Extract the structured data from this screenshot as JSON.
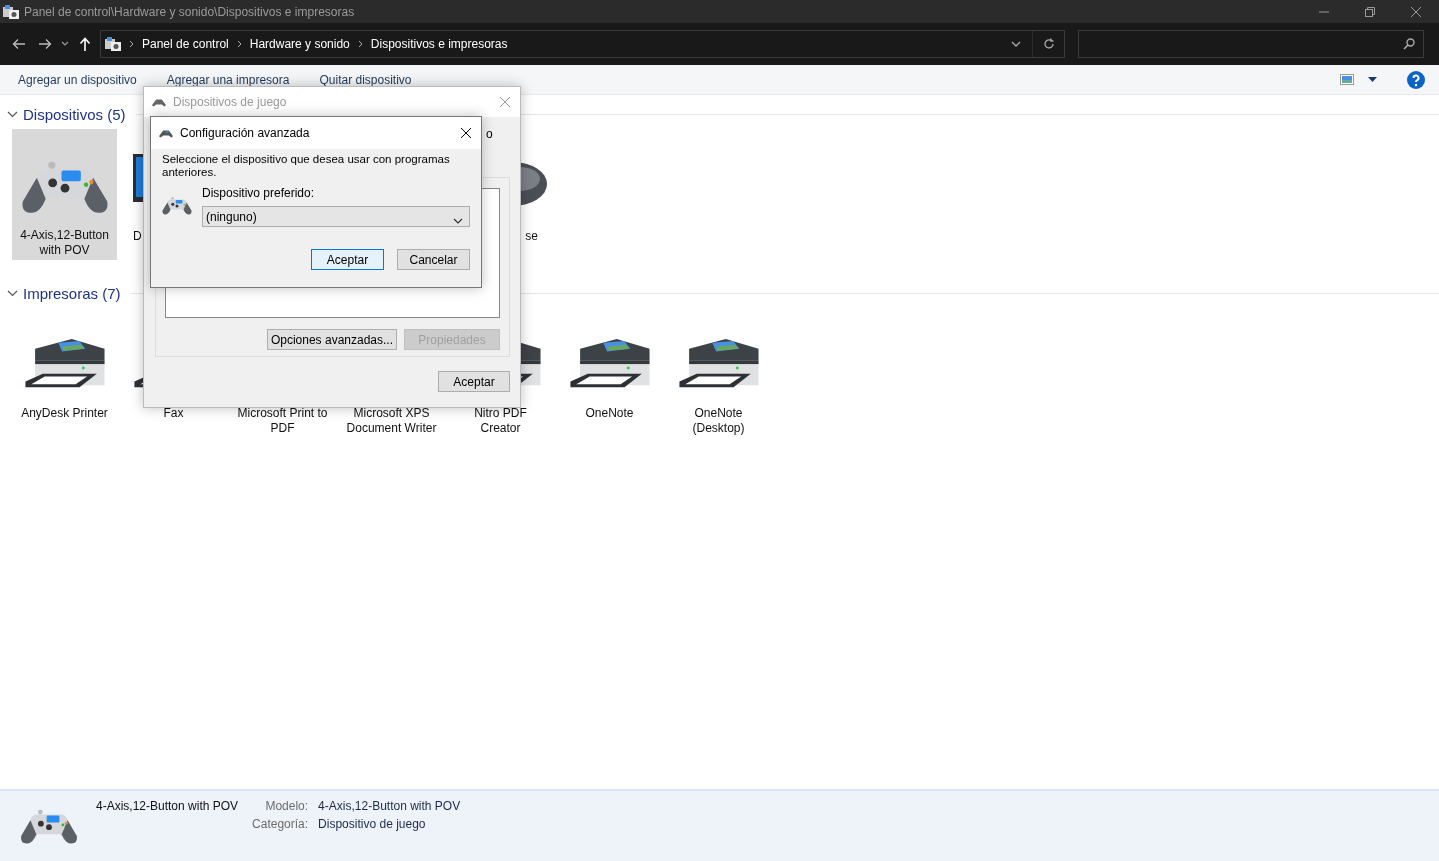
{
  "window": {
    "title": "Panel de control\\Hardware y sonido\\Dispositivos e impresoras"
  },
  "address": {
    "crumbs": [
      "Panel de control",
      "Hardware y sonido",
      "Dispositivos e impresoras"
    ]
  },
  "commands": [
    "Agregar un dispositivo",
    "Agregar una impresora",
    "Quitar dispositivo"
  ],
  "groups": [
    {
      "title": "Dispositivos (5)",
      "expanded": true,
      "items": [
        {
          "label": "4-Axis,12-Button with POV",
          "kind": "gamepad",
          "selected": true
        },
        {
          "label": "D",
          "kind": "monitor",
          "selected": false
        },
        {
          "label": "se",
          "kind": "mouse",
          "selected": false
        }
      ]
    },
    {
      "title": "Impresoras (7)",
      "expanded": true,
      "items": [
        {
          "label": "AnyDesk Printer",
          "kind": "printer",
          "selected": false
        },
        {
          "label": "Fax",
          "kind": "printer",
          "selected": false
        },
        {
          "label": "Microsoft Print to PDF",
          "kind": "printer",
          "selected": false
        },
        {
          "label": "Microsoft XPS Document Writer",
          "kind": "printer",
          "selected": false
        },
        {
          "label": "Nitro PDF Creator",
          "kind": "printer",
          "selected": false
        },
        {
          "label": "OneNote",
          "kind": "printer",
          "selected": false
        },
        {
          "label": "OneNote (Desktop)",
          "kind": "printer",
          "selected": false
        }
      ]
    }
  ],
  "details": {
    "name": "4-Axis,12-Button with POV",
    "fields": [
      {
        "label": "Modelo:",
        "value": "4-Axis,12-Button with POV"
      },
      {
        "label": "Categoría:",
        "value": "Dispositivo de juego"
      }
    ]
  },
  "game_dialog": {
    "title": "Dispositivos de juego",
    "fragment": "o",
    "buttons": [
      {
        "label": "Opciones avanzadas...",
        "disabled": false
      },
      {
        "label": "Propiedades",
        "disabled": true
      },
      {
        "label": "Aceptar",
        "disabled": false
      }
    ]
  },
  "config_dialog": {
    "title": "Configuración avanzada",
    "message": "Seleccione el dispositivo que desea usar con programas anteriores.",
    "field_label": "Dispositivo preferido:",
    "value": "(ninguno)",
    "buttons": [
      {
        "label": "Aceptar",
        "default": true
      },
      {
        "label": "Cancelar",
        "default": false
      }
    ]
  }
}
